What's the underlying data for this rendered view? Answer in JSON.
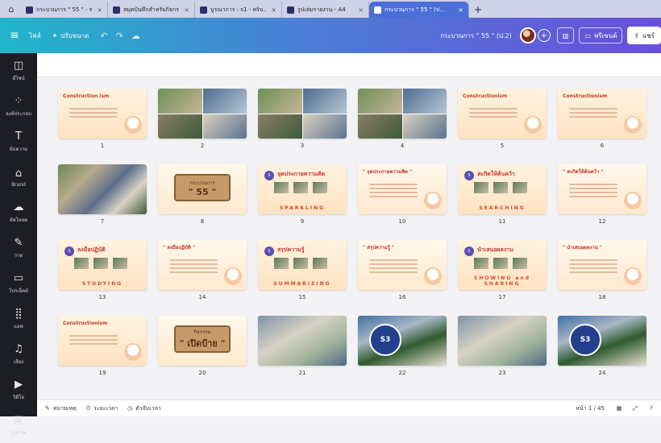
{
  "tabs": [
    {
      "label": "กระบวนการ \" 55 \" - พ...",
      "active": false
    },
    {
      "label": "สมุดบันทึกสำหรับกิจกร...",
      "active": false
    },
    {
      "label": "บูรณาการ : s1 - ทริบ...",
      "active": false
    },
    {
      "label": "รูปเล่มรายงาน - A4",
      "active": false
    },
    {
      "label": "กระบวนการ \" 55 \" (ป...",
      "active": true
    }
  ],
  "toolbar": {
    "file_label": "ไฟล์",
    "resize_label": "ปรับขนาด",
    "doc_title": "กระบวนการ \" 55 \" (ป.2)",
    "present_label": "พรีเซนต์",
    "share_label": "แชร์"
  },
  "sidebar": {
    "items": [
      {
        "icon": "design-icon",
        "label": "ดีไซน์"
      },
      {
        "icon": "elements-icon",
        "label": "องค์ประกอบ"
      },
      {
        "icon": "text-icon",
        "label": "ข้อความ"
      },
      {
        "icon": "brand-icon",
        "label": "Brand"
      },
      {
        "icon": "upload-icon",
        "label": "อัพโหลด"
      },
      {
        "icon": "draw-icon",
        "label": "วาด"
      },
      {
        "icon": "projects-icon",
        "label": "โปรเจ็คต์"
      },
      {
        "icon": "apps-icon",
        "label": "แอพ"
      },
      {
        "icon": "audio-icon",
        "label": "เสียง"
      },
      {
        "icon": "video-icon",
        "label": "วิดีโอ"
      },
      {
        "icon": "stock-icon",
        "label": "รูปภาพ"
      }
    ]
  },
  "slides": [
    {
      "n": "1",
      "kind": "title",
      "title": "Construction ism"
    },
    {
      "n": "2",
      "kind": "grid4"
    },
    {
      "n": "3",
      "kind": "grid4"
    },
    {
      "n": "4",
      "kind": "grid4"
    },
    {
      "n": "5",
      "kind": "warm",
      "title": "Constructionism"
    },
    {
      "n": "6",
      "kind": "warm",
      "title": "Constructionism"
    },
    {
      "n": "7",
      "kind": "photo"
    },
    {
      "n": "8",
      "kind": "wood",
      "w1": "กระบวนการ",
      "w2": "\" 55 \""
    },
    {
      "n": "9",
      "kind": "s",
      "title": "จุดประกายความคิด",
      "foot": "SPARKLING"
    },
    {
      "n": "10",
      "kind": "warm2",
      "title": "\" จุดประกายความคิด \""
    },
    {
      "n": "11",
      "kind": "s",
      "title": "สะกิดให้ค้นคว้า",
      "foot": "SEARCHING"
    },
    {
      "n": "12",
      "kind": "warm2",
      "title": "\" สะกิดให้ค้นคว้า \""
    },
    {
      "n": "13",
      "kind": "s",
      "title": "ลงมือปฏิบัติ",
      "foot": "STUDYING"
    },
    {
      "n": "14",
      "kind": "warm2",
      "title": "\" ลงมือปฏิบัติ \""
    },
    {
      "n": "15",
      "kind": "s",
      "title": "สรุปความรู้",
      "foot": "SUMMARIZING"
    },
    {
      "n": "16",
      "kind": "warm2",
      "title": "\" สรุปความรู้ \""
    },
    {
      "n": "17",
      "kind": "s",
      "title": "นำเสนอผลงาน",
      "foot": "SHOWING and SHARING"
    },
    {
      "n": "18",
      "kind": "warm2",
      "title": "\" นำเสนอผลงาน \""
    },
    {
      "n": "19",
      "kind": "warm",
      "title": "Constructionism"
    },
    {
      "n": "20",
      "kind": "wood",
      "w1": "กิจกรรม",
      "w2": "\" เปิดป้าย \""
    },
    {
      "n": "21",
      "kind": "photo-cls"
    },
    {
      "n": "22",
      "kind": "s3"
    },
    {
      "n": "23",
      "kind": "photo-cls"
    },
    {
      "n": "24",
      "kind": "s3"
    }
  ],
  "bottom": {
    "notes_label": "หมายเหตุ",
    "timer_label": "ระยะเวลา",
    "timer2_label": "ตัวจับเวลา",
    "page_indicator": "หน้า 1 / 45"
  }
}
